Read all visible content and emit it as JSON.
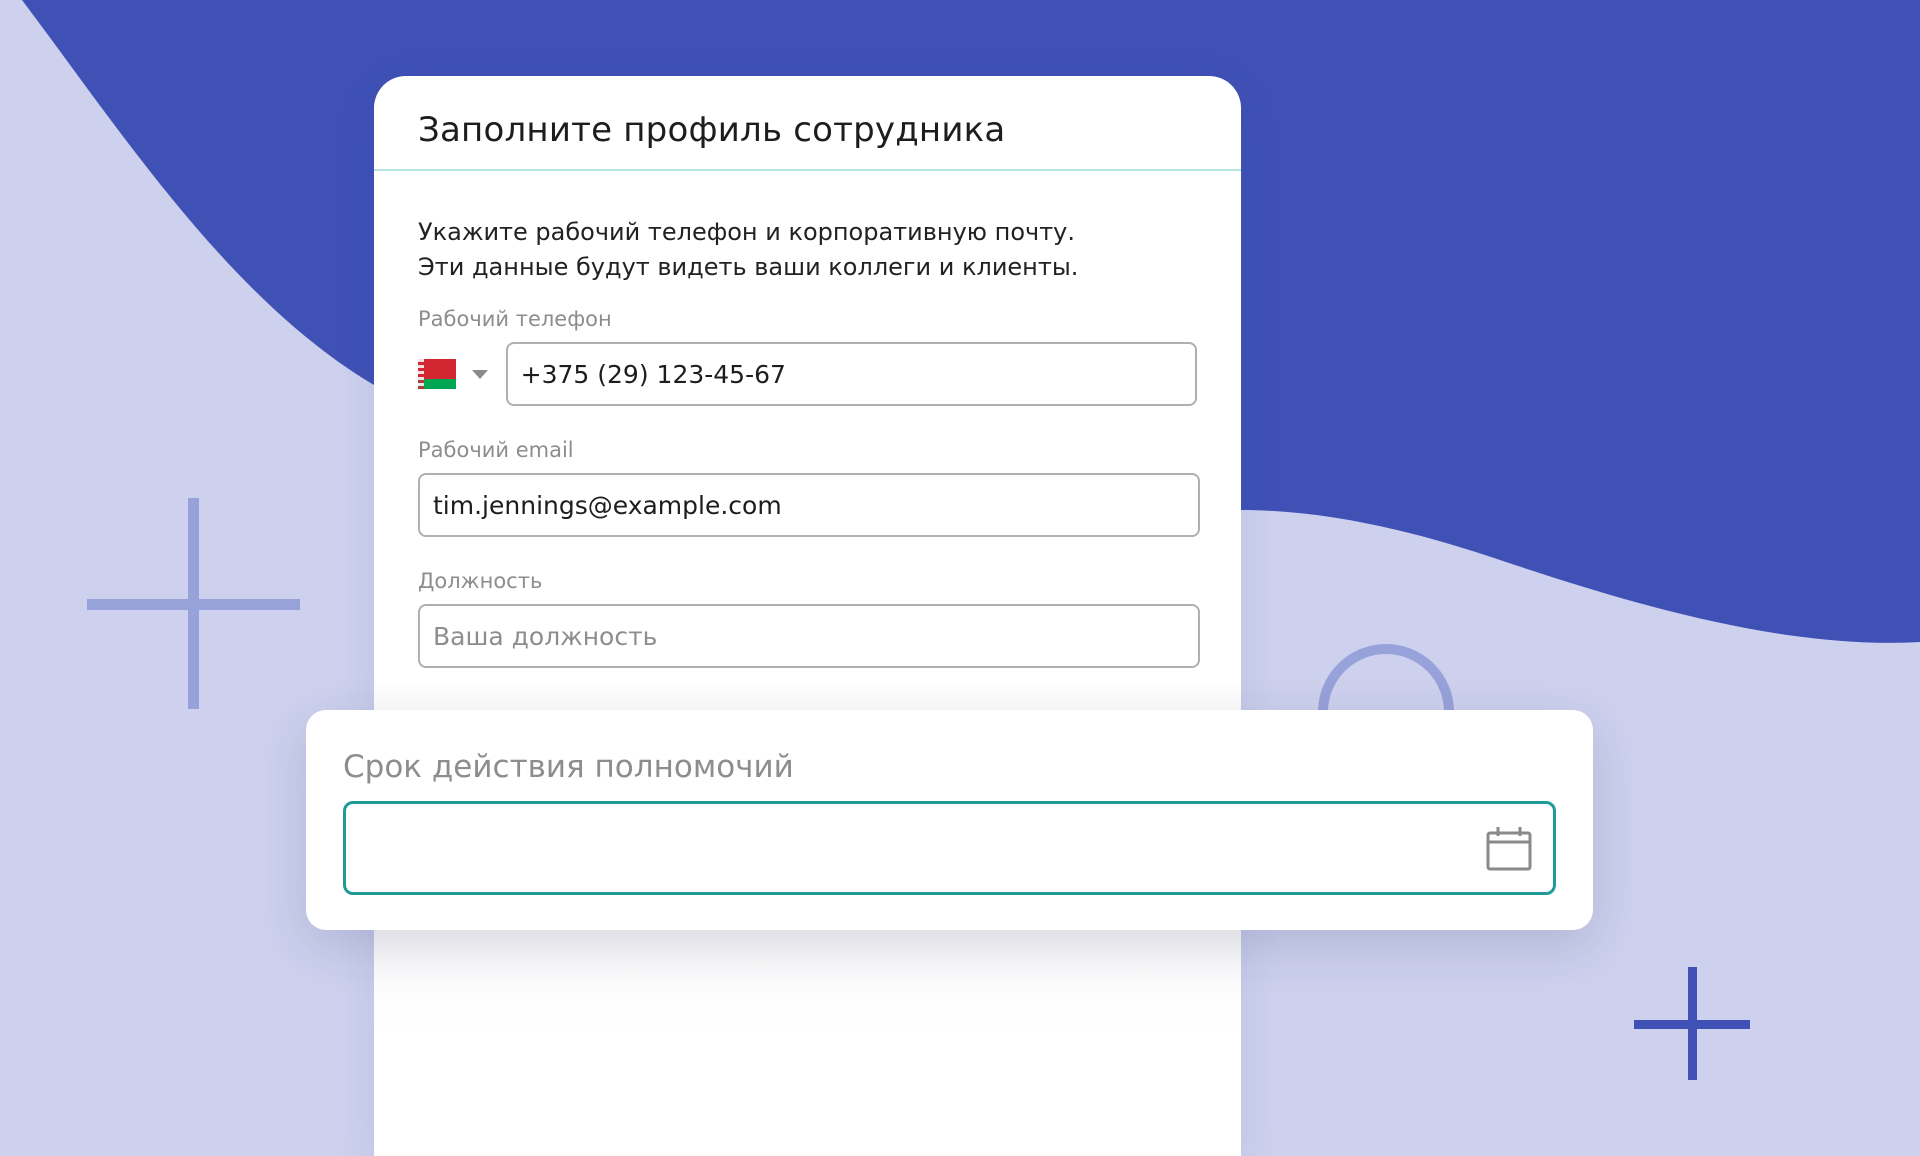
{
  "card": {
    "title": "Заполните профиль сотрудника",
    "intro_line1": "Укажите рабочий телефон и корпоративную почту.",
    "intro_line2": "Эти данные будут видеть ваши коллеги и клиенты."
  },
  "fields": {
    "phone": {
      "label": "Рабочий телефон",
      "value": "+375 (29) 123-45-67",
      "country_flag": "belarus-flag-icon"
    },
    "email": {
      "label": "Рабочий email",
      "value": "tim.jennings@example.com"
    },
    "position": {
      "label": "Должность",
      "placeholder": "Ваша должность"
    }
  },
  "popup": {
    "label": "Срок действия полномочий",
    "value": "",
    "icon": "calendar-icon"
  },
  "colors": {
    "background": "#cdd1ee",
    "accent_blue": "#3f51b5",
    "focus_teal": "#1f9a96",
    "plus_light": "#98a2da",
    "plus_dark": "#3f51b5"
  }
}
